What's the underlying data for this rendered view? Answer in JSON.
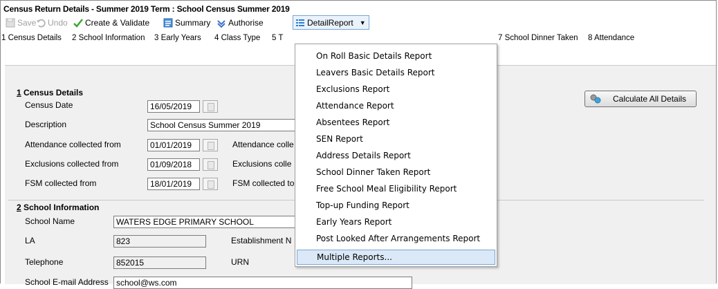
{
  "window": {
    "title": "Census Return Details - Summer 2019 Term : School Census Summer 2019"
  },
  "toolbar": {
    "save": "Save",
    "undo": "Undo",
    "create_validate": "Create & Validate",
    "summary": "Summary",
    "authorise": "Authorise",
    "detail_report": "DetailReport"
  },
  "nav": {
    "items": [
      "1 Census Details",
      "2 School Information",
      "3 Early Years",
      "4 Class Type",
      "5 T",
      "7 School Dinner Taken",
      "8 Attendance"
    ]
  },
  "census": {
    "heading_num": "1",
    "heading_text": " Census Details",
    "census_date_label": "Census Date",
    "census_date": "16/05/2019",
    "description_label": "Description",
    "description": "School Census Summer 2019",
    "attendance_from_label": "Attendance collected from",
    "attendance_from": "01/01/2019",
    "attendance_to_label": "Attendance colle",
    "exclusions_from_label": "Exclusions collected from",
    "exclusions_from": "01/09/2018",
    "exclusions_to_label": "Exclusions colle",
    "fsm_from_label": "FSM collected from",
    "fsm_from": "18/01/2019",
    "fsm_to_label": "FSM collected to",
    "calculate_all": "Calculate All Details"
  },
  "school": {
    "heading_num": "2",
    "heading_text": " School Information",
    "name_label": "School Name",
    "name": "WATERS EDGE PRIMARY SCHOOL",
    "la_label": "LA",
    "la": "823",
    "establishment_label": "Establishment N",
    "telephone_label": "Telephone",
    "telephone": "852015",
    "urn_label": "URN",
    "email_label": "School E-mail Address",
    "email": "school@ws.com"
  },
  "menu": {
    "items": [
      "On Roll Basic Details Report",
      "Leavers Basic Details Report",
      "Exclusions Report",
      "Attendance Report",
      "Absentees Report",
      "SEN Report",
      "Address Details Report",
      "School Dinner Taken Report",
      "Free School Meal Eligibility Report",
      "Top-up Funding Report",
      "Early Years Report",
      "Post Looked After Arrangements Report",
      "Multiple Reports..."
    ],
    "highlighted": "Multiple Reports..."
  },
  "colors": {
    "highlight": "#dbe8f7",
    "panel": "#f0f0f0",
    "accent": "#2a7fd4"
  }
}
